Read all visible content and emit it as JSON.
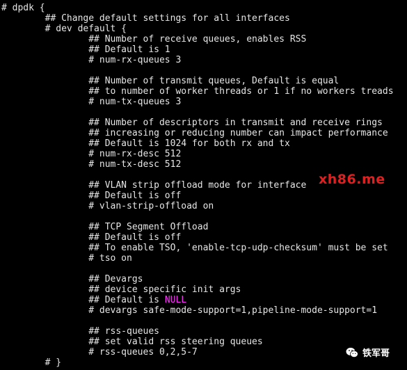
{
  "terminal": {
    "lines": [
      "# dpdk {",
      "        ## Change default settings for all interfaces",
      "        # dev default {",
      "                ## Number of receive queues, enables RSS",
      "                ## Default is 1",
      "                # num-rx-queues 3",
      "",
      "                ## Number of transmit queues, Default is equal",
      "                ## to number of worker threads or 1 if no workers treads",
      "                # num-tx-queues 3",
      "",
      "                ## Number of descriptors in transmit and receive rings",
      "                ## increasing or reducing number can impact performance",
      "                ## Default is 1024 for both rx and tx",
      "                # num-rx-desc 512",
      "                # num-tx-desc 512",
      "",
      "                ## VLAN strip offload mode for interface",
      "                ## Default is off",
      "                # vlan-strip-offload on",
      "",
      "                ## TCP Segment Offload",
      "                ## Default is off",
      "                ## To enable TSO, 'enable-tcp-udp-checksum' must be set",
      "                # tso on",
      "",
      "                ## Devargs",
      "                ## device specific init args",
      "                ## Default is ",
      "                # devargs safe-mode-support=1,pipeline-mode-support=1",
      "",
      "                ## rss-queues",
      "                ## set valid rss steering queues",
      "                # rss-queues 0,2,5-7",
      "        # }"
    ],
    "highlight": {
      "line_index": 28,
      "text": "NULL",
      "color": "#ff33ff"
    }
  },
  "watermark": {
    "text": "xh86.me",
    "color": "#e02020"
  },
  "brand": {
    "icon": "wechat-icon",
    "label": "铁军哥"
  }
}
